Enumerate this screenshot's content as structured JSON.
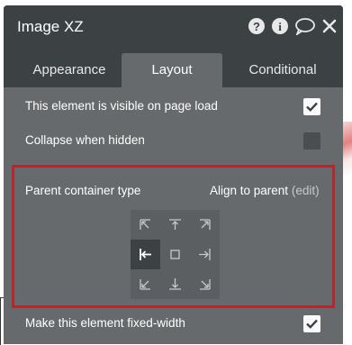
{
  "panel": {
    "title": "Image XZ",
    "header_icons": [
      "help-icon",
      "info-icon",
      "comment-icon",
      "close-icon"
    ],
    "tabs": [
      {
        "label": "Appearance",
        "active": false
      },
      {
        "label": "Layout",
        "active": true
      },
      {
        "label": "Conditional",
        "active": false
      }
    ],
    "options": {
      "visible_on_load": {
        "label": "This element is visible on page load",
        "checked": true
      },
      "collapse_when_hidden": {
        "label": "Collapse when hidden",
        "checked": false
      },
      "fixed_width": {
        "label": "Make this element fixed-width",
        "checked": true
      }
    },
    "parent_container": {
      "label": "Parent container type",
      "value": "Align to parent",
      "edit_link": "(edit)",
      "alignment_grid": [
        "top-left",
        "top-center",
        "top-right",
        "middle-left",
        "center",
        "middle-right",
        "bottom-left",
        "bottom-center",
        "bottom-right"
      ],
      "selected_alignment": "middle-left"
    }
  },
  "colors": {
    "panel_bg": "#676a6c",
    "header_bg": "#3c4143",
    "highlight": "#e1141c",
    "grid_bg": "#5c5f61"
  }
}
